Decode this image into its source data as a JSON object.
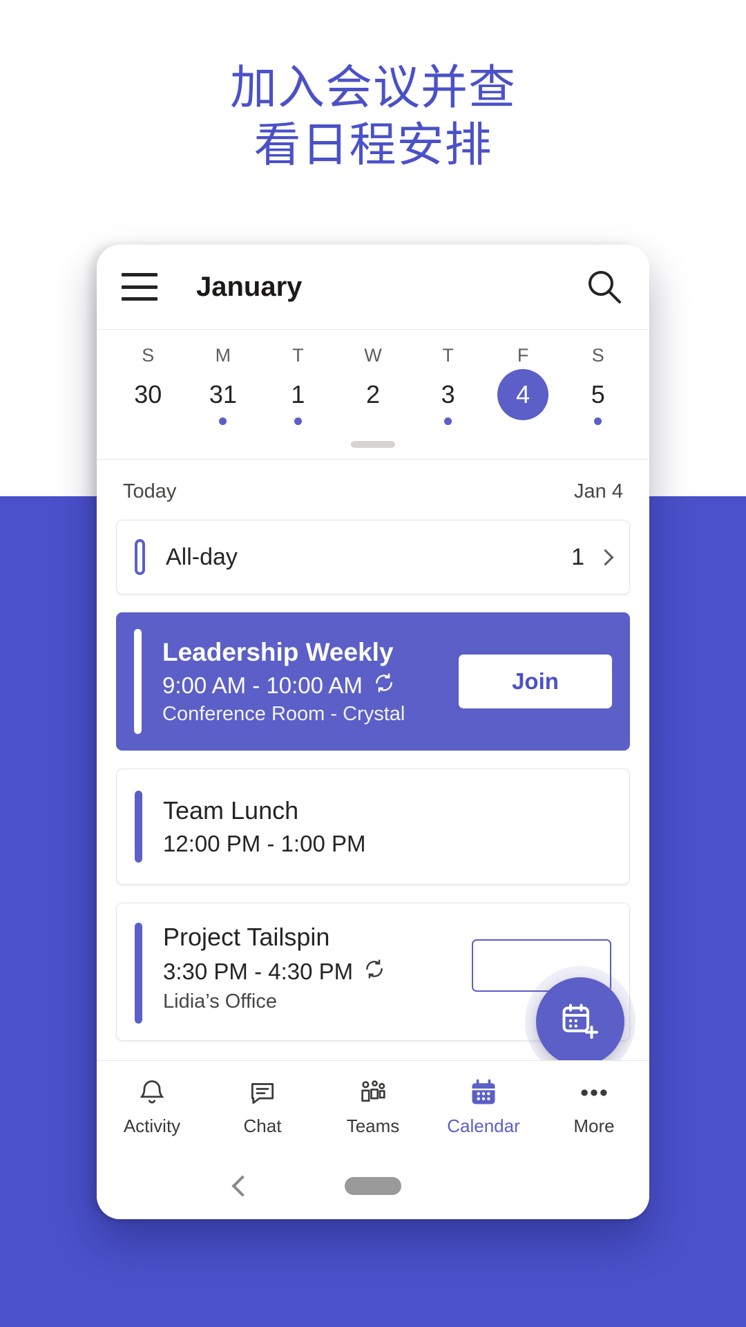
{
  "promo": {
    "headline": "加入会议并查\n看日程安排",
    "headline_color": "#4a51c8",
    "background_color": "#4a51ca"
  },
  "app": {
    "menu_icon": "hamburger-menu-icon",
    "title": "January",
    "search_icon": "search-icon"
  },
  "week": {
    "weekday_labels": [
      "S",
      "M",
      "T",
      "W",
      "T",
      "F",
      "S"
    ],
    "days": [
      {
        "date": "30",
        "selected": false,
        "has_event": false
      },
      {
        "date": "31",
        "selected": false,
        "has_event": true
      },
      {
        "date": "1",
        "selected": false,
        "has_event": true
      },
      {
        "date": "2",
        "selected": false,
        "has_event": false
      },
      {
        "date": "3",
        "selected": false,
        "has_event": true
      },
      {
        "date": "4",
        "selected": true,
        "has_event": false
      },
      {
        "date": "5",
        "selected": false,
        "has_event": true
      }
    ],
    "selected_color": "#5b5fc7"
  },
  "agenda": {
    "today_label": "Today",
    "date_label": "Jan 4",
    "allday": {
      "label": "All-day",
      "count": "1",
      "chevron_icon": "chevron-right-icon"
    },
    "events": [
      {
        "title": "Leadership Weekly",
        "time": "9:00 AM - 10:00 AM",
        "location": "Conference Room -  Crystal",
        "recurring": true,
        "recurring_icon": "recurrence-icon",
        "highlighted": true,
        "accent_color": "#5b5fc7",
        "join_label": "Join"
      },
      {
        "title": "Team Lunch",
        "time": "12:00 PM - 1:00 PM",
        "location": "",
        "recurring": false,
        "highlighted": false,
        "accent_color": "#5b5fc7"
      },
      {
        "title": "Project Tailspin",
        "time": "3:30 PM - 4:30 PM",
        "location": "Lidia’s Office",
        "recurring": true,
        "recurring_icon": "recurrence-icon",
        "highlighted": false,
        "accent_color": "#5b5fc7"
      }
    ],
    "fab": {
      "icon": "add-event-calendar-icon",
      "color": "#5b5fc7"
    }
  },
  "bottom_nav": {
    "active": "Calendar",
    "items": [
      {
        "label": "Activity",
        "icon": "bell-icon",
        "active": false
      },
      {
        "label": "Chat",
        "icon": "chat-icon",
        "active": false
      },
      {
        "label": "Teams",
        "icon": "teams-icon",
        "active": false
      },
      {
        "label": "Calendar",
        "icon": "calendar-icon",
        "active": true
      },
      {
        "label": "More",
        "icon": "more-dots-icon",
        "active": false
      }
    ],
    "active_color": "#5b5fc7"
  },
  "system_nav": {
    "back_icon": "back-chevron-icon",
    "home_indicator": "home-pill-indicator"
  }
}
